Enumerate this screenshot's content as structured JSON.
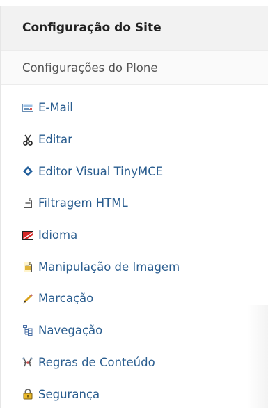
{
  "portlet": {
    "title": "Configuração do Site",
    "subtitle": "Configurações do Plone",
    "items": [
      {
        "label": "E-Mail",
        "icon": "mail-icon"
      },
      {
        "label": "Editar",
        "icon": "scissors-icon"
      },
      {
        "label": "Editor Visual TinyMCE",
        "icon": "tinymce-icon"
      },
      {
        "label": "Filtragem HTML",
        "icon": "document-icon"
      },
      {
        "label": "Idioma",
        "icon": "language-flag-icon"
      },
      {
        "label": "Manipulação de Imagem",
        "icon": "image-document-icon"
      },
      {
        "label": "Marcação",
        "icon": "pencil-icon"
      },
      {
        "label": "Navegação",
        "icon": "navigation-tree-icon"
      },
      {
        "label": "Regras de Conteúdo",
        "icon": "content-rules-icon"
      },
      {
        "label": "Segurança",
        "icon": "lock-icon"
      }
    ]
  },
  "colors": {
    "link": "#2a5d8f",
    "header_bg": "#f2f2f2"
  }
}
